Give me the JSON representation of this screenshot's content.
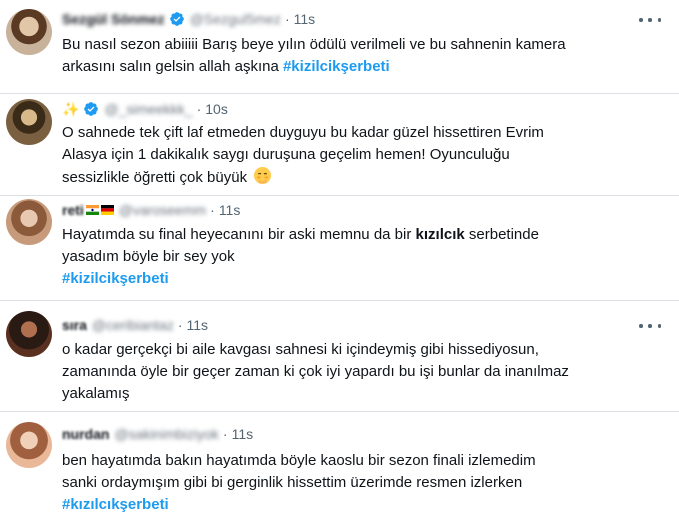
{
  "tweets": [
    {
      "name": "Sezgül Sönmez",
      "handle": "@Sezgul5mez",
      "verified": true,
      "time": "11s",
      "show_more": true,
      "lines": [
        "Bu nasıl sezon abiiiii Barış beye yılın ödülü verilmeli ve bu sahnenin kamera",
        "arkasını salın gelsin allah aşkına"
      ],
      "hashtag": "#kizilcikşerbeti"
    },
    {
      "name": "✨",
      "handle": "@_simeekkk_",
      "verified": true,
      "time": "10s",
      "show_more": false,
      "lines": [
        "O sahnede tek çift laf etmeden duyguyu bu kadar güzel hissettiren Evrim",
        "Alasya için 1 dakikalık saygı duruşuna geçelim hemen! Oyunculuğu",
        "sessizlikle öğretti çok büyük"
      ],
      "emoji": "smiling-face-with-hand-over-mouth"
    },
    {
      "name": "reti",
      "handle": "@varoseemm",
      "verified": false,
      "flags": [
        "flag-india-icon",
        "flag-germany-icon"
      ],
      "time": "11s",
      "show_more": false,
      "line1": "Hayatımda su final heyecanını bir aski memnu da bir",
      "bold_word": "kızılcık",
      "line1_end": "serbetinde",
      "line2": "yasadım böyle bir sey yok",
      "hashtag": "#kizilcikşerbeti"
    },
    {
      "name": "sıra",
      "handle": "@ceribiantaz",
      "verified": false,
      "time": "11s",
      "show_more": true,
      "lines": [
        "o kadar gerçekçi bi aile kavgası sahnesi ki içindeymiş gibi hissediyosun,",
        "zamanında öyle bir geçer zaman ki çok iyi yapardı bu işi  bunlar da inanılmaz",
        "yakalamış"
      ]
    },
    {
      "name": "nurdan",
      "handle": "@sakinimbiziyok",
      "verified": false,
      "time": "11s",
      "show_more": false,
      "lines": [
        "ben hayatımda bakın hayatımda böyle kaoslu bir sezon finali izlemedim",
        "sanki ordaymışım gibi bi gerginlik hissettim üzerimde resmen izlerken"
      ],
      "hashtag": "#kızılcıkşerbeti"
    }
  ],
  "colors": {
    "hashtag": "#1d9bf0",
    "verified": "#1d9bf0",
    "meta": "#536471",
    "divider": "#dcdfe3"
  }
}
